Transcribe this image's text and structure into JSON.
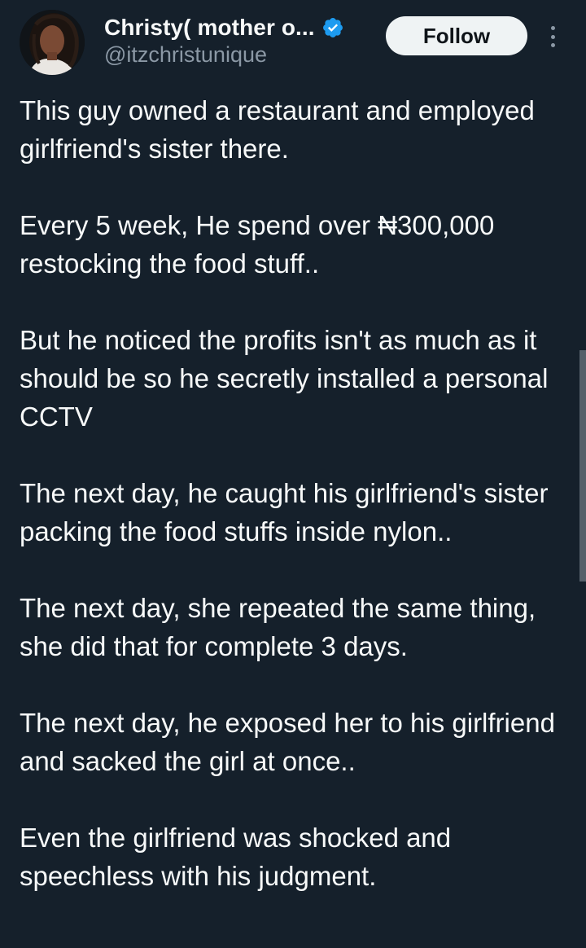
{
  "author": {
    "display_name": "Christy( mother o...",
    "handle": "@itzchristunique",
    "verified": true,
    "avatar_icon": "profile-photo"
  },
  "actions": {
    "follow_label": "Follow",
    "more_icon": "vertical-ellipsis-icon"
  },
  "tweet": {
    "paragraphs": [
      "This guy owned a restaurant and employed girlfriend's sister there.",
      "Every 5 week, He spend over ₦300,000 restocking the food stuff..",
      "But he noticed the profits isn't as much as it should be so he secretly installed a personal CCTV",
      "The next day, he caught his girlfriend's sister packing the food stuffs inside nylon..",
      "The next day, she repeated the same thing, she did that for complete 3 days.",
      "The next day, he exposed her to his girlfriend and sacked the girl at once..",
      "Even the girlfriend was shocked and speechless with his judgment."
    ]
  },
  "colors": {
    "background": "#15202b",
    "text_primary": "#f7f9f9",
    "text_secondary": "#8b98a5",
    "verified_blue": "#1d9bf0",
    "follow_bg": "#eff3f4"
  }
}
